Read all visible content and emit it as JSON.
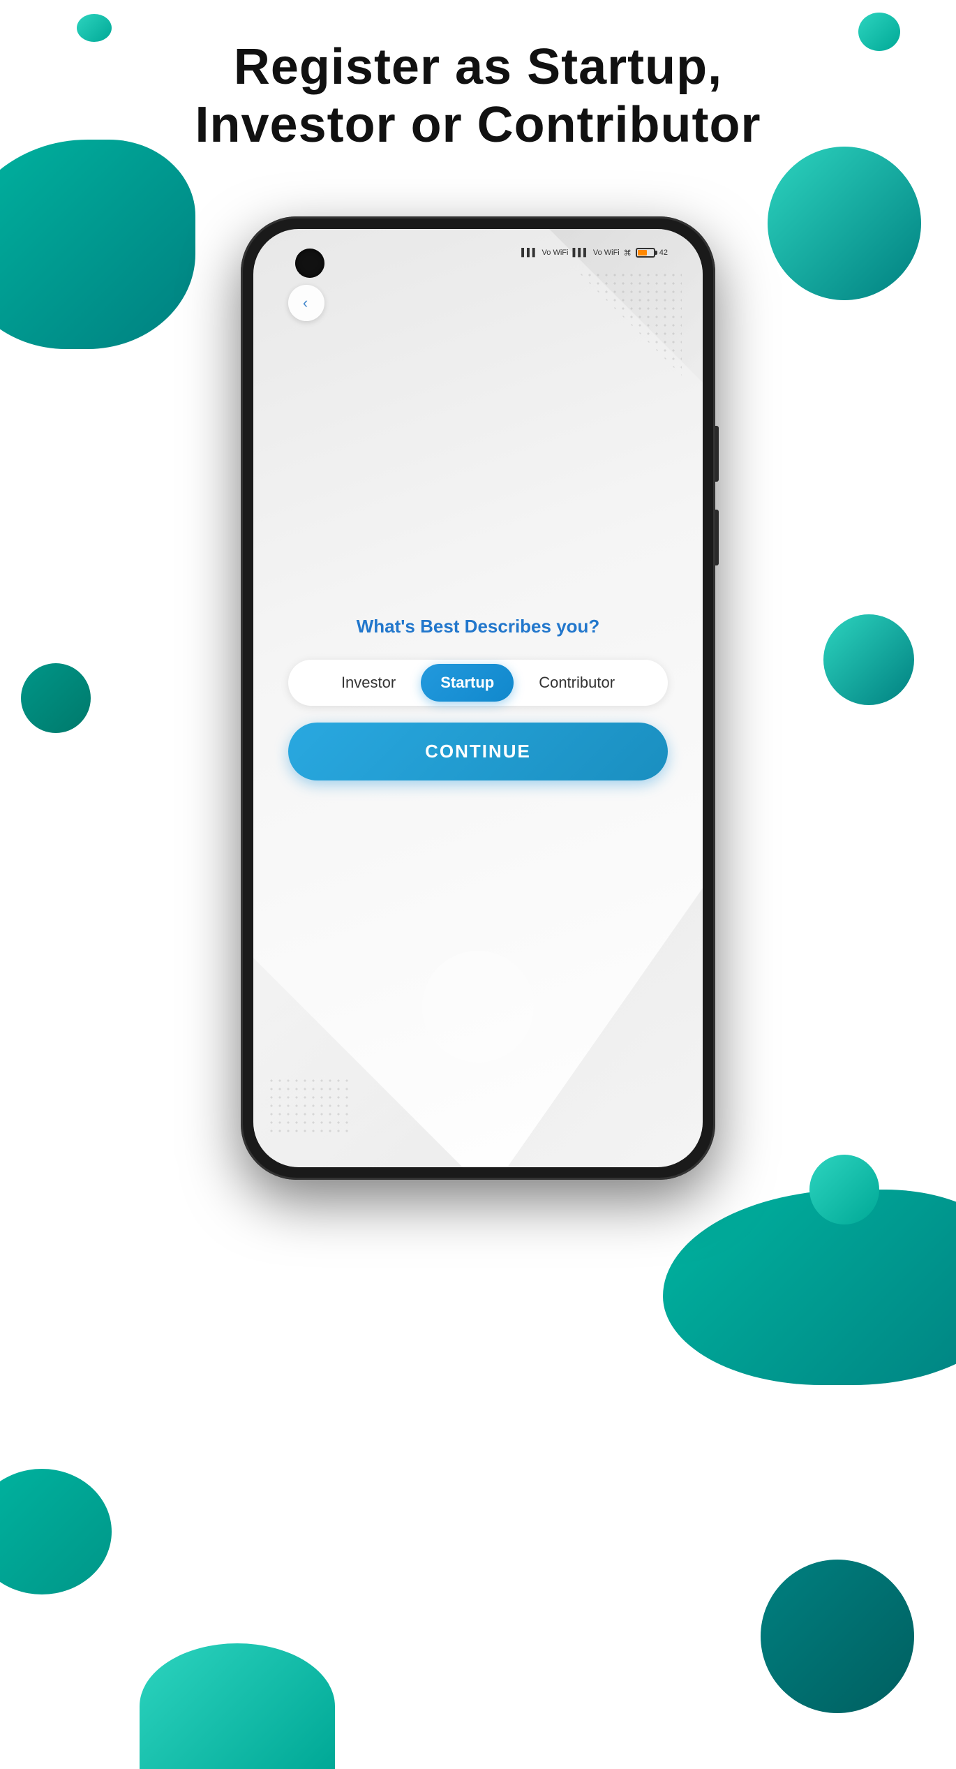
{
  "page": {
    "title": "Register as Startup, Investor or Contributor",
    "title_line1": "Register as Startup,",
    "title_line2": "Investor or Contributor"
  },
  "blobs": {
    "colors": {
      "teal": "#2dd4bf",
      "dark_teal": "#008080",
      "mid_teal": "#009688"
    }
  },
  "screen": {
    "question": "What's Best Describes you?",
    "roles": [
      {
        "label": "Investor",
        "active": false
      },
      {
        "label": "Startup",
        "active": true
      },
      {
        "label": "Contributor",
        "active": false
      }
    ],
    "continue_button": "CONTINUE",
    "back_button": "‹",
    "status_bar": {
      "signal1": "▌▌▌",
      "wifi1": "Vo WiFi",
      "signal2": "▌▌▌",
      "wifi2": "Vo WiFi",
      "wifi3": "WiFi",
      "battery": "42"
    }
  }
}
